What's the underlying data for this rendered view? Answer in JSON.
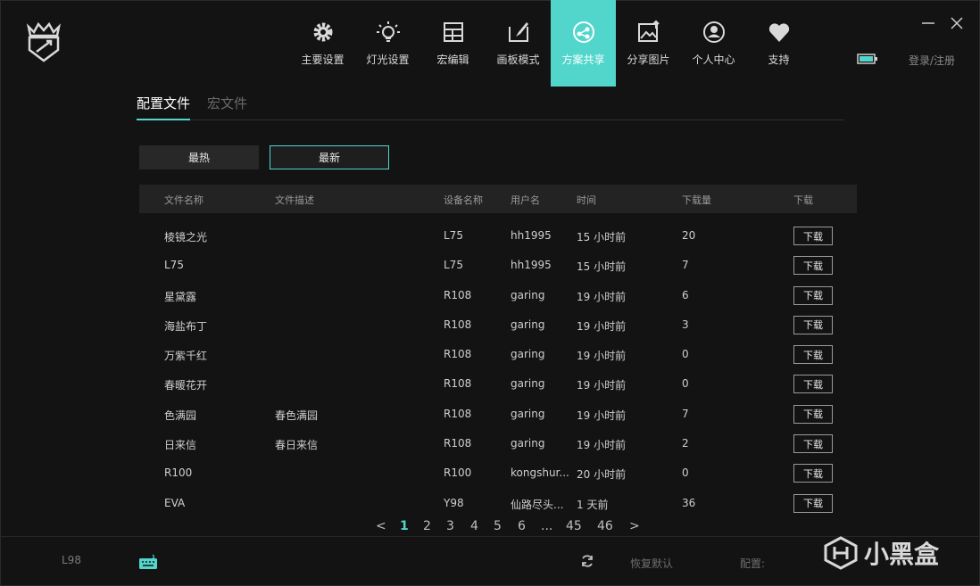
{
  "nav": {
    "items": [
      {
        "label": "主要设置",
        "icon": "gear-icon"
      },
      {
        "label": "灯光设置",
        "icon": "lightbulb-icon"
      },
      {
        "label": "宏编辑",
        "icon": "macro-grid-icon"
      },
      {
        "label": "画板模式",
        "icon": "paint-brush-icon"
      },
      {
        "label": "方案共享",
        "icon": "share-profile-icon"
      },
      {
        "label": "分享图片",
        "icon": "share-image-icon"
      },
      {
        "label": "个人中心",
        "icon": "user-icon"
      },
      {
        "label": "支持",
        "icon": "heart-icon"
      }
    ],
    "active_index": 4
  },
  "header": {
    "login_label": "登录/注册"
  },
  "colors": {
    "accent": "#52d6cc",
    "background": "#131313"
  },
  "tabs": [
    {
      "label": "配置文件",
      "active": true
    },
    {
      "label": "宏文件",
      "active": false
    }
  ],
  "sort": {
    "hot_label": "最热",
    "new_label": "最新",
    "selected": "最新"
  },
  "table": {
    "columns": {
      "file": "文件名称",
      "desc": "文件描述",
      "device": "设备名称",
      "user": "用户名",
      "time": "时间",
      "count": "下载量",
      "download": "下载"
    },
    "download_label": "下载",
    "rows": [
      {
        "file": "棱镜之光",
        "desc": "",
        "device": "L75",
        "user": "hh1995",
        "time": "15 小时前",
        "count": "20"
      },
      {
        "file": "L75",
        "desc": "",
        "device": "L75",
        "user": "hh1995",
        "time": "15 小时前",
        "count": "7"
      },
      {
        "file": "星黛露",
        "desc": "",
        "device": "R108",
        "user": "garing",
        "time": "19 小时前",
        "count": "6"
      },
      {
        "file": "海盐布丁",
        "desc": "",
        "device": "R108",
        "user": "garing",
        "time": "19 小时前",
        "count": "3"
      },
      {
        "file": "万紫千红",
        "desc": "",
        "device": "R108",
        "user": "garing",
        "time": "19 小时前",
        "count": "0"
      },
      {
        "file": "春暖花开",
        "desc": "",
        "device": "R108",
        "user": "garing",
        "time": "19 小时前",
        "count": "0"
      },
      {
        "file": "色满园",
        "desc": "春色满园",
        "device": "R108",
        "user": "garing",
        "time": "19 小时前",
        "count": "7"
      },
      {
        "file": "日来信",
        "desc": "春日来信",
        "device": "R108",
        "user": "garing",
        "time": "19 小时前",
        "count": "2"
      },
      {
        "file": "R100",
        "desc": "",
        "device": "R100",
        "user": "kongshur...",
        "time": "20 小时前",
        "count": "0"
      },
      {
        "file": "EVA",
        "desc": "",
        "device": "Y98",
        "user": "仙路尽头...",
        "time": "1 天前",
        "count": "36"
      }
    ]
  },
  "pagination": {
    "prev": "<",
    "next": ">",
    "pages": [
      "1",
      "2",
      "3",
      "4",
      "5",
      "6",
      "...",
      "45",
      "46"
    ],
    "current": "1"
  },
  "bottom": {
    "model": "L98",
    "restore_label": "恢复默认",
    "config_label": "配置:"
  },
  "watermark": {
    "text": "小黑盒"
  }
}
